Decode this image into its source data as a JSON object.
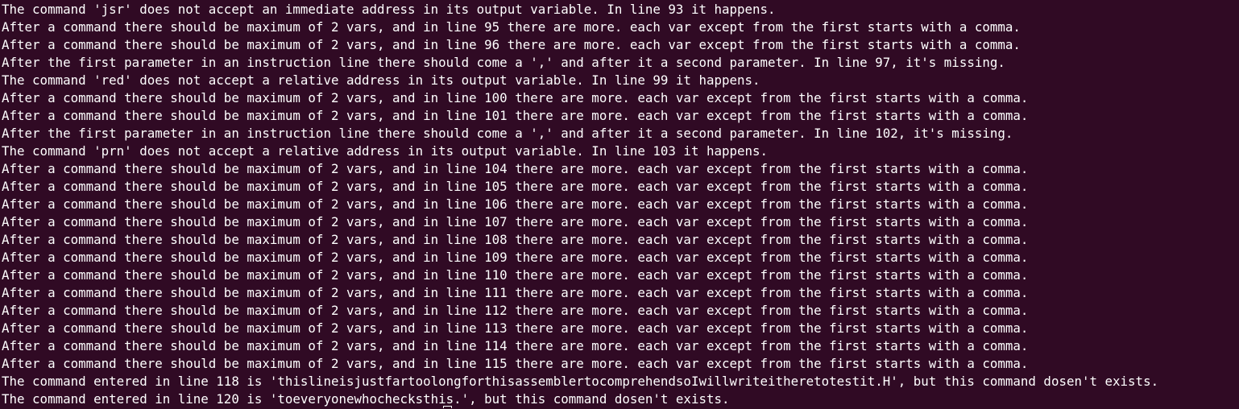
{
  "terminal": {
    "background_color": "#300a24",
    "text_color": "#ffffff",
    "lines": [
      "The command 'jsr' does not accept an immediate address in its output variable. In line 93 it happens.",
      "After a command there should be maximum of 2 vars, and in line 95 there are more. each var except from the first starts with a comma.",
      "After a command there should be maximum of 2 vars, and in line 96 there are more. each var except from the first starts with a comma.",
      "After the first parameter in an instruction line there should come a ',' and after it a second parameter. In line 97, it's missing.",
      "The command 'red' does not accept a relative address in its output variable. In line 99 it happens.",
      "After a command there should be maximum of 2 vars, and in line 100 there are more. each var except from the first starts with a comma.",
      "After a command there should be maximum of 2 vars, and in line 101 there are more. each var except from the first starts with a comma.",
      "After the first parameter in an instruction line there should come a ',' and after it a second parameter. In line 102, it's missing.",
      "The command 'prn' does not accept a relative address in its output variable. In line 103 it happens.",
      "After a command there should be maximum of 2 vars, and in line 104 there are more. each var except from the first starts with a comma.",
      "After a command there should be maximum of 2 vars, and in line 105 there are more. each var except from the first starts with a comma.",
      "After a command there should be maximum of 2 vars, and in line 106 there are more. each var except from the first starts with a comma.",
      "After a command there should be maximum of 2 vars, and in line 107 there are more. each var except from the first starts with a comma.",
      "After a command there should be maximum of 2 vars, and in line 108 there are more. each var except from the first starts with a comma.",
      "After a command there should be maximum of 2 vars, and in line 109 there are more. each var except from the first starts with a comma.",
      "After a command there should be maximum of 2 vars, and in line 110 there are more. each var except from the first starts with a comma.",
      "After a command there should be maximum of 2 vars, and in line 111 there are more. each var except from the first starts with a comma.",
      "After a command there should be maximum of 2 vars, and in line 112 there are more. each var except from the first starts with a comma.",
      "After a command there should be maximum of 2 vars, and in line 113 there are more. each var except from the first starts with a comma.",
      "After a command there should be maximum of 2 vars, and in line 114 there are more. each var except from the first starts with a comma.",
      "After a command there should be maximum of 2 vars, and in line 115 there are more. each var except from the first starts with a comma.",
      "The command entered in line 118 is 'thislineisjustfartoolongforthisassemblertocomprehendsoIwillwriteitheretotestit.H', but this command dosen't exists.",
      "The command entered in line 120 is 'toeveryonewhochecksthis.', but this command dosen't exists."
    ]
  }
}
